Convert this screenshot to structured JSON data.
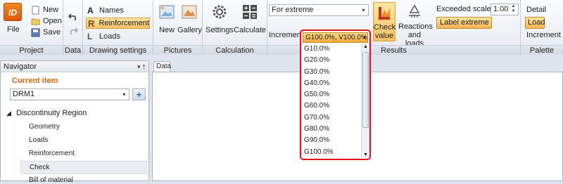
{
  "ribbon": {
    "groups": {
      "project": "Project",
      "data": "Data",
      "drawing": "Drawing settings",
      "pictures": "Pictures",
      "calculation": "Calculation",
      "results": "Results",
      "palette": "Palette"
    },
    "file": {
      "logo": "ID",
      "label": "File"
    },
    "new": "New",
    "open": "Open",
    "save": "Save",
    "names": "Names",
    "reinforcement": "Reinforcement",
    "loads": "Loads",
    "pic_new": "New",
    "gallery": "Gallery",
    "settings": "Settings",
    "calculate": "Calculate",
    "extreme_combo": "For extreme",
    "increment_label": "Increment",
    "check_value": [
      "Check",
      "value"
    ],
    "reactions": [
      "Reactions",
      "and loads"
    ],
    "exceeded_scale_label": "Exceeded scale",
    "exceeded_scale_value": "1.00",
    "label_extreme": "Label extreme",
    "detail": "Detail",
    "load": "Load",
    "palette_increment": "Increment"
  },
  "navigator": {
    "title": "Navigator",
    "current_label": "Current item",
    "current_value": "DRM1",
    "tree_root": "Discontinuity Region",
    "items": [
      "Geometry",
      "Loads",
      "Reinforcement",
      "Check",
      "Bill of material"
    ]
  },
  "data_tab": "Data",
  "increment_dropdown": {
    "selected": "G100.0%, V100.0%",
    "options": [
      "G10.0%",
      "G20.0%",
      "G30.0%",
      "G40.0%",
      "G50.0%",
      "G60.0%",
      "G70.0%",
      "G80.0%",
      "G90.0%",
      "G100.0%"
    ]
  }
}
